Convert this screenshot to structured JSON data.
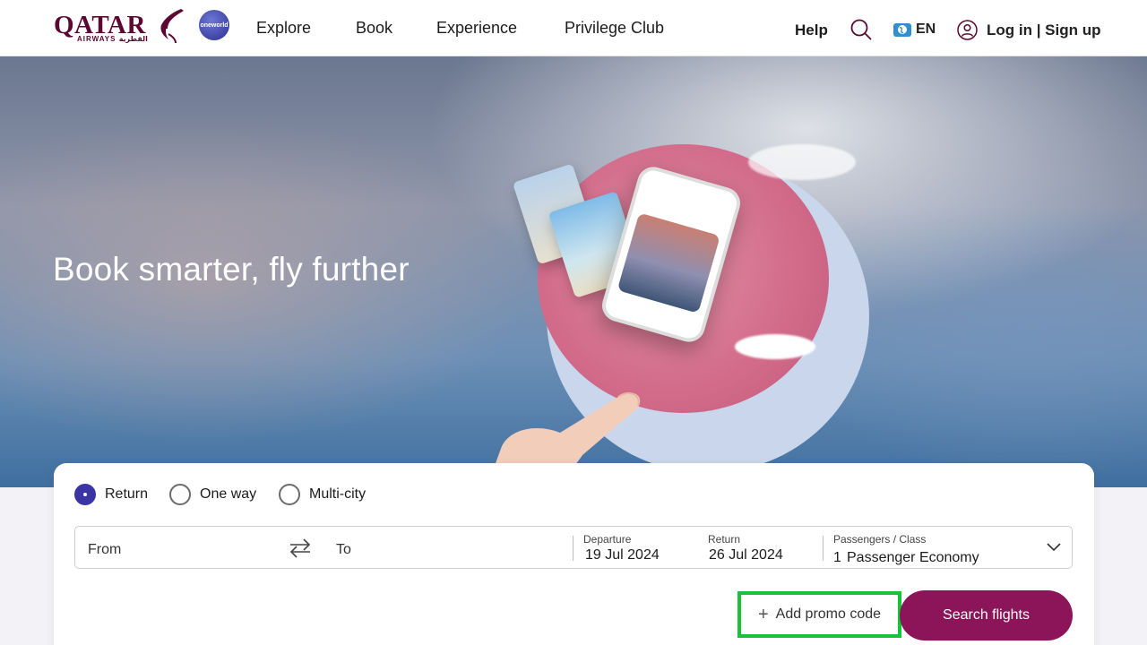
{
  "brand": {
    "logo_text": "QATAR",
    "logo_sub": "AIRWAYS القطرية",
    "alliance_badge": "oneworld",
    "brand_color": "#5c0632"
  },
  "nav": {
    "items": [
      {
        "label": "Explore"
      },
      {
        "label": "Book"
      },
      {
        "label": "Experience"
      },
      {
        "label": "Privilege Club"
      }
    ]
  },
  "header_actions": {
    "help": "Help",
    "search_icon": "search-icon",
    "language": "EN",
    "language_icon": "globe-icon",
    "login": "Log in | Sign up",
    "login_icon": "user-icon"
  },
  "hero": {
    "title": "Book smarter, fly further"
  },
  "booking": {
    "trip_types": [
      {
        "label": "Return",
        "selected": true
      },
      {
        "label": "One way",
        "selected": false
      },
      {
        "label": "Multi-city",
        "selected": false
      }
    ],
    "from_placeholder": "From",
    "to_placeholder": "To",
    "departure": {
      "label": "Departure",
      "value": "19 Jul 2024"
    },
    "return": {
      "label": "Return",
      "value": "26 Jul 2024"
    },
    "passengers": {
      "label": "Passengers / Class",
      "count": "1",
      "class": "Passenger Economy"
    },
    "promo_label": "Add promo code",
    "search_label": "Search flights",
    "accent_color": "#8c1459",
    "radio_color": "#3b34a5",
    "highlight_color": "#18c23b"
  }
}
